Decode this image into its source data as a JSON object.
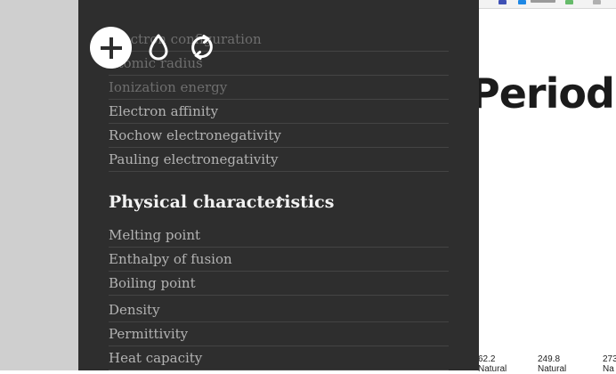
{
  "page": {
    "title": "Periodi",
    "table_cells": [
      {
        "value": "62.2",
        "sub": "Natural"
      },
      {
        "value": "249.8",
        "sub": "Natural"
      },
      {
        "value": "273",
        "sub": "Na"
      }
    ]
  },
  "panel": {
    "toolbar": {
      "add_icon": "plus-icon",
      "drop_icon": "drop-icon",
      "refresh_icon": "refresh-icon"
    },
    "top_items": [
      "Electron configuration",
      "Atomic radius",
      "Ionization energy",
      "Electron affinity",
      "Rochow electronegativity",
      "Pauling electronegativity"
    ],
    "physical_heading": "Physical characteristics",
    "physical_items": [
      "Melting point",
      "Enthalpy of fusion",
      "Boiling point",
      "Density",
      "Permittivity",
      "Heat capacity"
    ]
  },
  "colors": {
    "panel_bg": "#2e2e2e",
    "item_text": "#b3b3b3",
    "heading_text": "#f2f2f2",
    "divider": "#444444"
  }
}
